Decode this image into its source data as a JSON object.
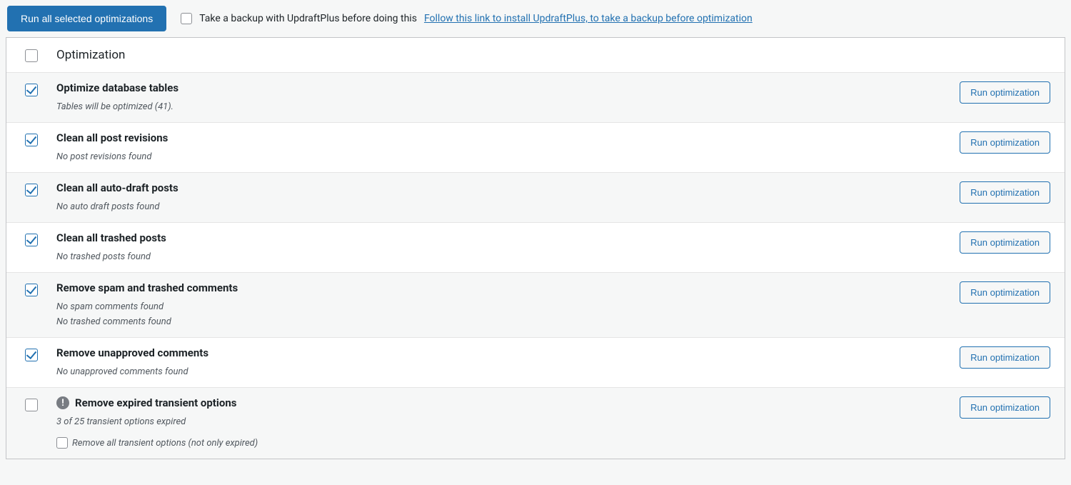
{
  "top": {
    "run_all_label": "Run all selected optimizations",
    "backup_text": "Take a backup with UpdraftPlus before doing this",
    "backup_link": "Follow this link to install UpdraftPlus, to take a backup before optimization"
  },
  "table": {
    "header_label": "Optimization",
    "run_btn_label": "Run optimization"
  },
  "items": [
    {
      "id": "optimize-db",
      "checked": true,
      "alt": true,
      "warn": false,
      "title": "Optimize database tables",
      "desc": "Tables will be optimized (41).",
      "desc2": "",
      "sub_checkbox": false,
      "sub_label": ""
    },
    {
      "id": "clean-revisions",
      "checked": true,
      "alt": false,
      "warn": false,
      "title": "Clean all post revisions",
      "desc": "No post revisions found",
      "desc2": "",
      "sub_checkbox": false,
      "sub_label": ""
    },
    {
      "id": "clean-autodraft",
      "checked": true,
      "alt": true,
      "warn": false,
      "title": "Clean all auto-draft posts",
      "desc": "No auto draft posts found",
      "desc2": "",
      "sub_checkbox": false,
      "sub_label": ""
    },
    {
      "id": "clean-trashed",
      "checked": true,
      "alt": false,
      "warn": false,
      "title": "Clean all trashed posts",
      "desc": "No trashed posts found",
      "desc2": "",
      "sub_checkbox": false,
      "sub_label": ""
    },
    {
      "id": "remove-spam",
      "checked": true,
      "alt": true,
      "warn": false,
      "title": "Remove spam and trashed comments",
      "desc": "No spam comments found",
      "desc2": "No trashed comments found",
      "sub_checkbox": false,
      "sub_label": ""
    },
    {
      "id": "remove-unapproved",
      "checked": true,
      "alt": false,
      "warn": false,
      "title": "Remove unapproved comments",
      "desc": "No unapproved comments found",
      "desc2": "",
      "sub_checkbox": false,
      "sub_label": ""
    },
    {
      "id": "remove-transients",
      "checked": false,
      "alt": true,
      "warn": true,
      "title": "Remove expired transient options",
      "desc": "3 of 25 transient options expired",
      "desc2": "",
      "sub_checkbox": true,
      "sub_label": "Remove all transient options (not only expired)"
    }
  ]
}
